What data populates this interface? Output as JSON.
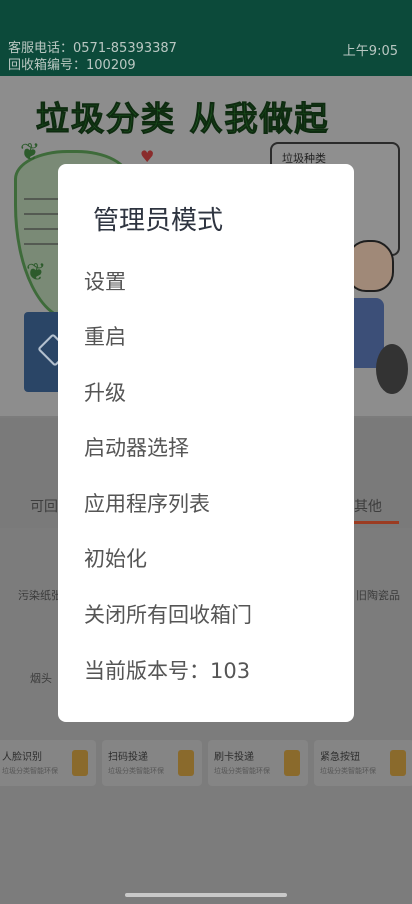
{
  "status_bar": {
    "service_phone": "客服电话：0571-85393387",
    "bin_number": "回收箱编号：100209",
    "time": "上午9:05"
  },
  "poster": {
    "title": "垃圾分类 从我做起",
    "right_tag": "垃圾种类",
    "bin_label": "可回收"
  },
  "categories": {
    "left_label": "可回",
    "right_label": "其他"
  },
  "grid": {
    "items": [
      "污染纸张",
      "旧陶瓷品",
      "烟头"
    ]
  },
  "action_buttons": [
    {
      "label": "人脸识别",
      "sub": "垃圾分类智能环保"
    },
    {
      "label": "扫码投递",
      "sub": "垃圾分类智能环保"
    },
    {
      "label": "刷卡投递",
      "sub": "垃圾分类智能环保"
    },
    {
      "label": "紧急按钮",
      "sub": "垃圾分类智能环保"
    }
  ],
  "dialog": {
    "title": "管理员模式",
    "items": [
      "设置",
      "重启",
      "升级",
      "启动器选择",
      "应用程序列表",
      "初始化",
      "关闭所有回收箱门",
      "当前版本号：103"
    ]
  },
  "colors": {
    "status_bar_bg": "#0c4a3a",
    "dialog_bg": "#ffffff",
    "scrim": "#7c7c7c",
    "accent_underline": "#9b3c22"
  }
}
